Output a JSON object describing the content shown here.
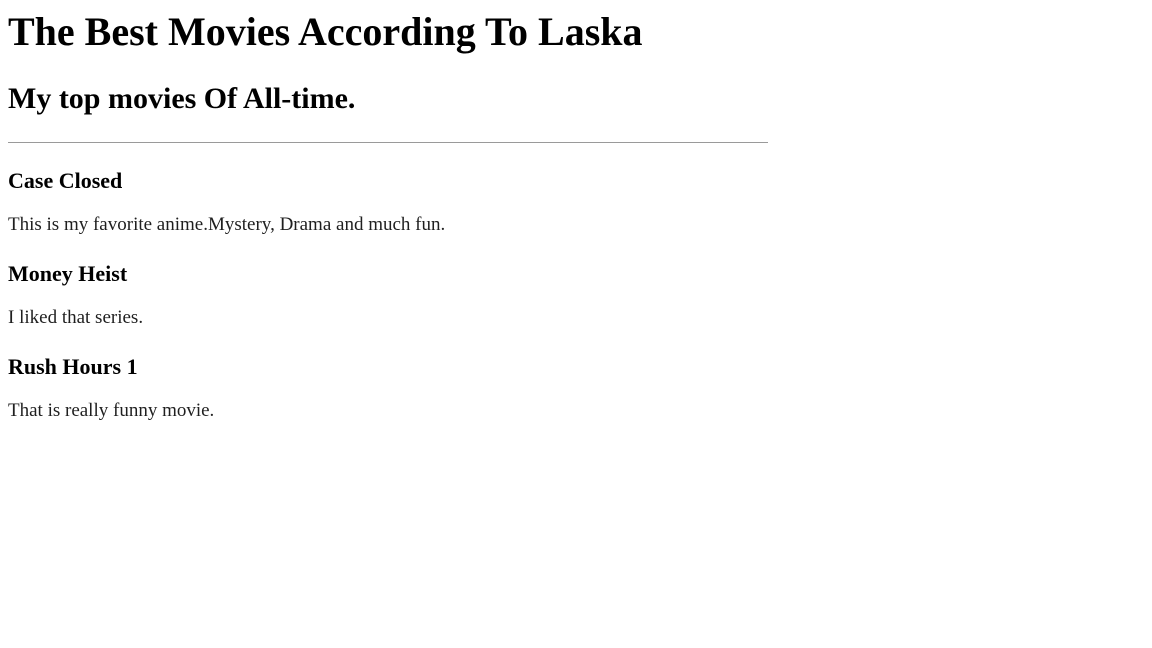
{
  "header": {
    "title": "The Best Movies According To Laska",
    "subtitle": "My top movies Of All-time."
  },
  "movies": [
    {
      "title": "Case Closed",
      "description": "This is my favorite anime.Mystery, Drama and much fun."
    },
    {
      "title": "Money Heist",
      "description": "I liked that series."
    },
    {
      "title": "Rush Hours 1",
      "description": "That is really funny movie."
    }
  ]
}
